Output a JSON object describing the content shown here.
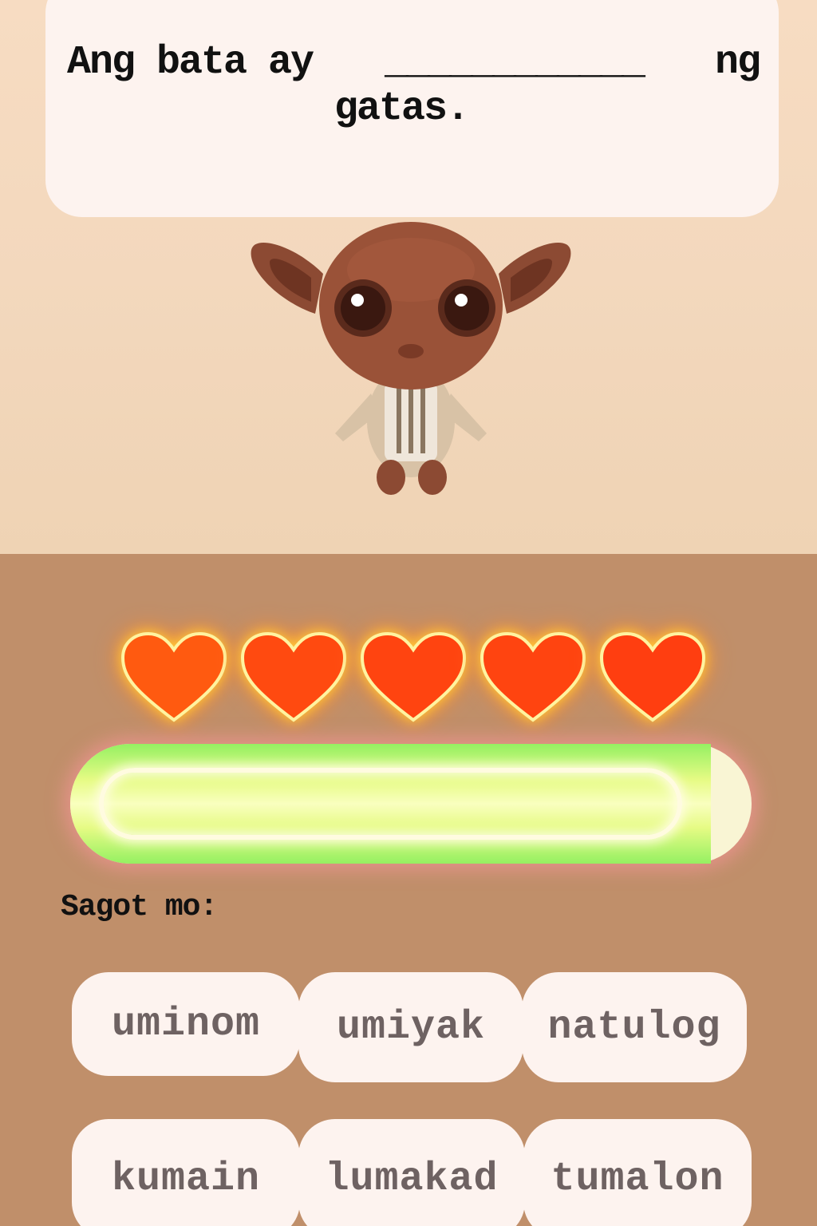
{
  "question": {
    "before_blank": "Ang bata ay",
    "blank": "____________",
    "after_blank": "ng",
    "line2": "gatas."
  },
  "lives": {
    "remaining": 5,
    "total": 5,
    "color": "#ff4a10",
    "glow": "#ffd23a",
    "icon": "heart-icon"
  },
  "progress": {
    "fraction": 0.94,
    "fill_color": "#e6fb84",
    "track_color": "#f9f5d4"
  },
  "answer_label": "Sagot mo:",
  "choices": [
    {
      "label": "uminom"
    },
    {
      "label": "umiyak"
    },
    {
      "label": "natulog"
    },
    {
      "label": "kumain"
    },
    {
      "label": "lumakad"
    },
    {
      "label": "tumalon"
    }
  ],
  "colors": {
    "top_background": "#f3d8bd",
    "bottom_background": "#c08f6a",
    "card": "#fdf3ef"
  }
}
